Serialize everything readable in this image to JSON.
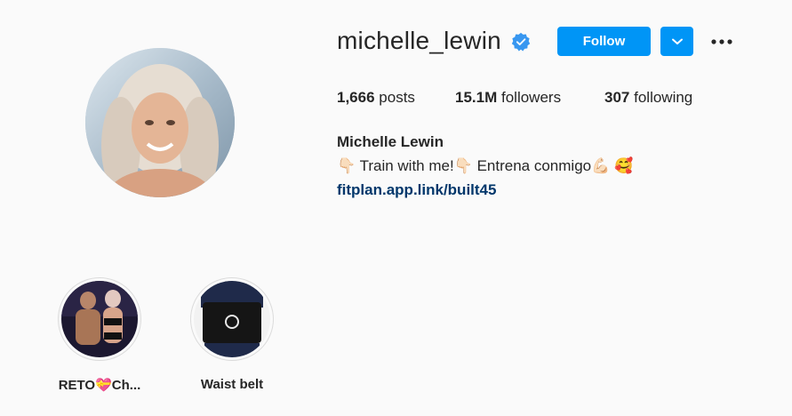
{
  "profile": {
    "username": "michelle_lewin",
    "full_name": "Michelle Lewin",
    "bio": "👇🏻 Train with me!👇🏻 Entrena conmigo💪🏻 🥰",
    "link": "fitplan.app.link/built45",
    "verified_icon": "verified-badge"
  },
  "actions": {
    "follow_label": "Follow",
    "dropdown_icon": "chevron-down-icon",
    "more_icon": "more-horizontal-icon"
  },
  "stats": {
    "posts_count": "1,666",
    "posts_label": "posts",
    "followers_count": "15.1M",
    "followers_label": "followers",
    "following_count": "307",
    "following_label": "following"
  },
  "highlights": [
    {
      "label": "RETO💝Ch..."
    },
    {
      "label": "Waist belt"
    }
  ],
  "colors": {
    "primary": "#0095f6",
    "link": "#00376b",
    "text": "#262626",
    "background": "#fafafa"
  }
}
